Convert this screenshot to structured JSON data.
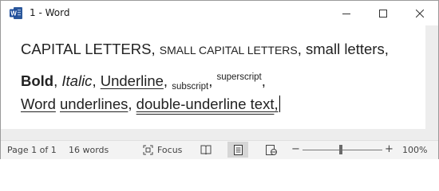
{
  "window": {
    "title": "1 - Word",
    "app_icon": "word-app-icon",
    "controls": [
      "minimize-icon",
      "maximize-icon",
      "close-icon"
    ]
  },
  "document": {
    "line1": {
      "caps": "CAPITAL LETTERS",
      "sep1": ", ",
      "small_caps": "SMALL CAPITAL LETTERS",
      "sep2": ", ",
      "small": "small letters",
      "sep3": ","
    },
    "line2": {
      "bold": "Bold",
      "sep1": ", ",
      "italic": "Italic",
      "sep2": ", ",
      "underline": "Underline",
      "sep3": ", ",
      "subscript": "subscript",
      "sep4": ", ",
      "superscript": "superscript",
      "sep5": ","
    },
    "line3": {
      "word1": "Word",
      "space": " ",
      "word2": "underlines",
      "sep1": ", ",
      "double": "double-underline text",
      "sep2": ","
    }
  },
  "statusbar": {
    "page": "Page 1 of 1",
    "words": "16 words",
    "focus": "Focus",
    "zoom": "100%",
    "zoom_minus": "−",
    "zoom_plus": "+",
    "zoom_level_percent": 100
  },
  "colors": {
    "word_blue": "#2b579a",
    "text": "#222222"
  }
}
